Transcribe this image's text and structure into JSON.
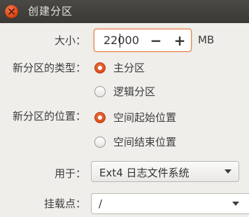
{
  "window": {
    "title": "创建分区"
  },
  "size": {
    "label": "大小：",
    "value": "22000",
    "unit": "MB",
    "minus": "−",
    "plus": "+"
  },
  "partition_type": {
    "label": "新分区的类型：",
    "options": [
      {
        "label": "主分区",
        "selected": true
      },
      {
        "label": "逻辑分区",
        "selected": false
      }
    ]
  },
  "partition_position": {
    "label": "新分区的位置：",
    "options": [
      {
        "label": "空间起始位置",
        "selected": true
      },
      {
        "label": "空间结束位置",
        "selected": false
      }
    ]
  },
  "use_as": {
    "label": "用于：",
    "value": "Ext4 日志文件系统"
  },
  "mount_point": {
    "label": "挂载点：",
    "value": "/"
  },
  "colors": {
    "accent": "#dd4814",
    "titlebar": "#3c3b37",
    "background": "#efeeeb"
  }
}
